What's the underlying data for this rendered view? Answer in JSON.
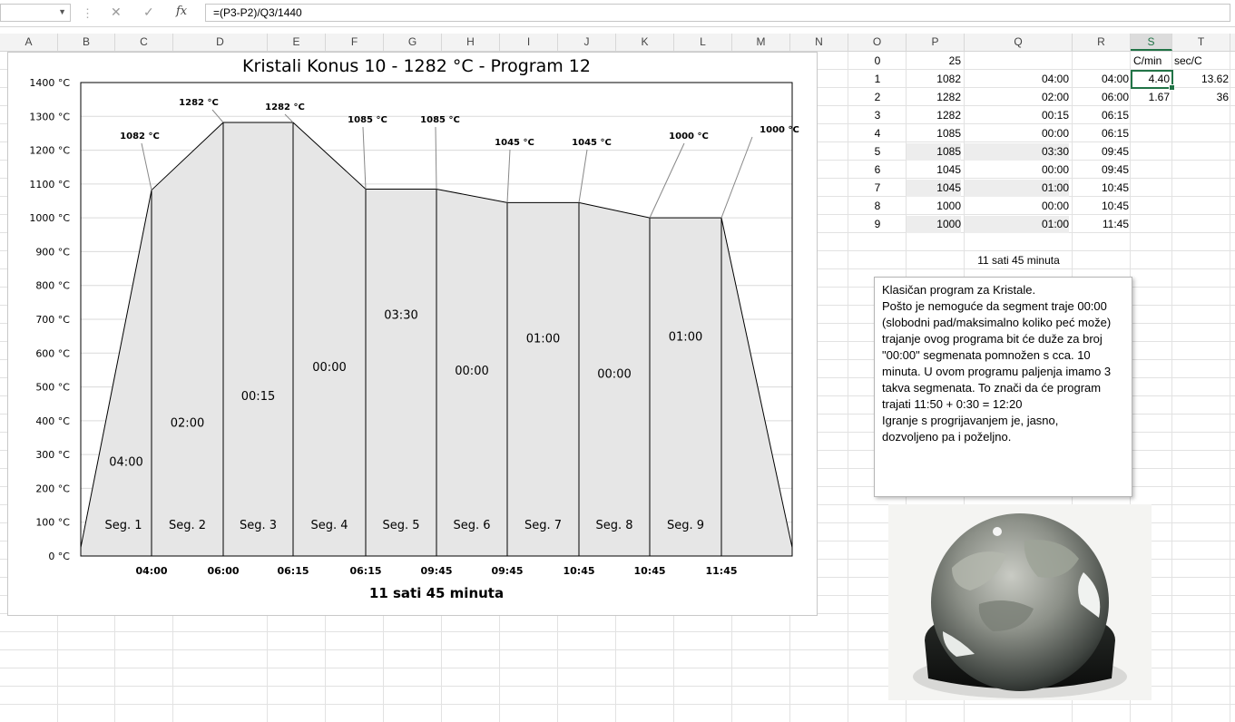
{
  "formula_bar": {
    "formula": "=(P3-P2)/Q3/1440",
    "cancel_icon": "close-icon",
    "enter_icon": "check-icon",
    "fx_label": "fx"
  },
  "columns": [
    "A",
    "B",
    "C",
    "D",
    "E",
    "F",
    "G",
    "H",
    "I",
    "J",
    "K",
    "L",
    "M",
    "N",
    "O",
    "P",
    "Q",
    "R",
    "S",
    "T"
  ],
  "selected_column": "S",
  "table": {
    "headers": {
      "s": "C/min",
      "t": "sec/C"
    },
    "rows": [
      {
        "o": "0",
        "p": "25",
        "q": "",
        "r": "",
        "s": "",
        "t": ""
      },
      {
        "o": "1",
        "p": "1082",
        "q": "04:00",
        "r": "04:00",
        "s": "4.40",
        "t": "13.62"
      },
      {
        "o": "2",
        "p": "1282",
        "q": "02:00",
        "r": "06:00",
        "s": "1.67",
        "t": "36"
      },
      {
        "o": "3",
        "p": "1282",
        "q": "00:15",
        "r": "06:15",
        "s": "",
        "t": ""
      },
      {
        "o": "4",
        "p": "1085",
        "q": "00:00",
        "r": "06:15",
        "s": "",
        "t": ""
      },
      {
        "o": "5",
        "p": "1085",
        "q": "03:30",
        "r": "09:45",
        "s": "",
        "t": ""
      },
      {
        "o": "6",
        "p": "1045",
        "q": "00:00",
        "r": "09:45",
        "s": "",
        "t": ""
      },
      {
        "o": "7",
        "p": "1045",
        "q": "01:00",
        "r": "10:45",
        "s": "",
        "t": ""
      },
      {
        "o": "8",
        "p": "1000",
        "q": "00:00",
        "r": "10:45",
        "s": "",
        "t": ""
      },
      {
        "o": "9",
        "p": "1000",
        "q": "01:00",
        "r": "11:45",
        "s": "",
        "t": ""
      }
    ],
    "total": "11 sati 45 minuta"
  },
  "note": {
    "lines": [
      "Klasičan program za Kristale.",
      "Pošto je nemoguće da segment traje 00:00",
      "(slobodni pad/maksimalno koliko peć može)",
      "trajanje ovog programa bit će duže za broj",
      "\"00:00\" segmenata pomnožen s cca. 10",
      "minuta. U ovom programu paljenja imamo 3",
      "takva segmenata. To znači da će program",
      "trajati 11:50 + 0:30 = 12:20",
      "Igranje s progrijavanjem je, jasno,",
      "dozvoljeno pa i poželjno."
    ]
  },
  "chart_data": {
    "type": "area",
    "title": "Kristali Konus 10 - 1282 °C - Program 12",
    "xlabel": "11 sati 45 minuta",
    "ylabel": "",
    "ylim": [
      0,
      1400
    ],
    "y_ticks": [
      "0 °C",
      "100 °C",
      "200 °C",
      "300 °C",
      "400 °C",
      "500 °C",
      "600 °C",
      "700 °C",
      "800 °C",
      "900 °C",
      "1000 °C",
      "1100 °C",
      "1200 °C",
      "1300 °C",
      "1400 °C"
    ],
    "grid": true,
    "fill_color": "#e6e6e6",
    "points": [
      {
        "temp": 25,
        "label": ""
      },
      {
        "temp": 1082,
        "label": "1082  °C"
      },
      {
        "temp": 1282,
        "label": "1282  °C"
      },
      {
        "temp": 1282,
        "label": "1282  °C"
      },
      {
        "temp": 1085,
        "label": "1085  °C"
      },
      {
        "temp": 1085,
        "label": "1085  °C"
      },
      {
        "temp": 1045,
        "label": "1045  °C"
      },
      {
        "temp": 1045,
        "label": "1045  °C"
      },
      {
        "temp": 1000,
        "label": "1000  °C"
      },
      {
        "temp": 1000,
        "label": "1000  °C"
      },
      {
        "temp": 25,
        "label": ""
      }
    ],
    "x_tick_labels": [
      "04:00",
      "06:00",
      "06:15",
      "06:15",
      "09:45",
      "09:45",
      "10:45",
      "10:45",
      "11:45"
    ],
    "segments": [
      {
        "name": "Seg. 1",
        "duration": "04:00",
        "duration_temp": 280
      },
      {
        "name": "Seg. 2",
        "duration": "02:00",
        "duration_temp": 395
      },
      {
        "name": "Seg. 3",
        "duration": "00:15",
        "duration_temp": 475
      },
      {
        "name": "Seg. 4",
        "duration": "00:00",
        "duration_temp": 560
      },
      {
        "name": "Seg. 5",
        "duration": "03:30",
        "duration_temp": 715
      },
      {
        "name": "Seg. 6",
        "duration": "00:00",
        "duration_temp": 550
      },
      {
        "name": "Seg. 7",
        "duration": "01:00",
        "duration_temp": 645
      },
      {
        "name": "Seg. 8",
        "duration": "00:00",
        "duration_temp": 540
      },
      {
        "name": "Seg. 9",
        "duration": "01:00",
        "duration_temp": 650
      }
    ]
  }
}
